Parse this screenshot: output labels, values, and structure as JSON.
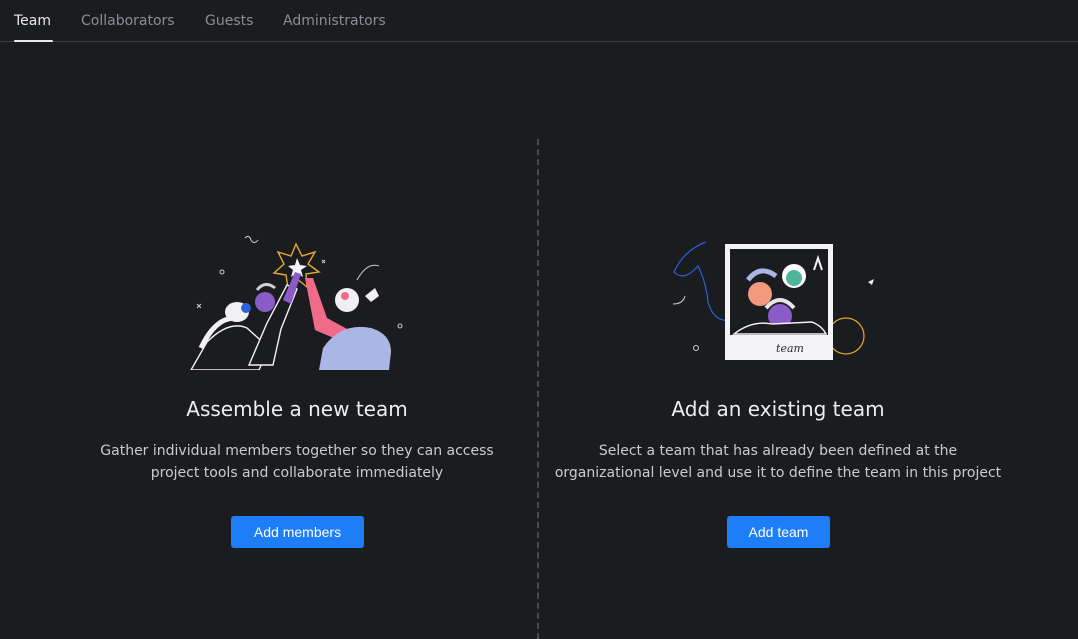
{
  "tabs": [
    {
      "label": "Team",
      "active": true
    },
    {
      "label": "Collaborators",
      "active": false
    },
    {
      "label": "Guests",
      "active": false
    },
    {
      "label": "Administrators",
      "active": false
    }
  ],
  "new_team": {
    "title": "Assemble a new team",
    "description_line1": "Gather individual members together so they can access",
    "description_line2": "project tools and collaborate immediately",
    "button_label": "Add members",
    "illustration": "high-five-illustration"
  },
  "existing_team": {
    "title": "Add an existing team",
    "description_line1": "Select a team that has already been defined at the",
    "description_line2": "organizational level and use it to define the team in this project",
    "button_label": "Add team",
    "illustration": "team-photo-illustration",
    "photo_caption": "team"
  },
  "colors": {
    "background": "#1b1c1f",
    "accent": "#1e7ef7",
    "tab_active": "#e9eaec",
    "tab_inactive": "#8a8d94"
  }
}
